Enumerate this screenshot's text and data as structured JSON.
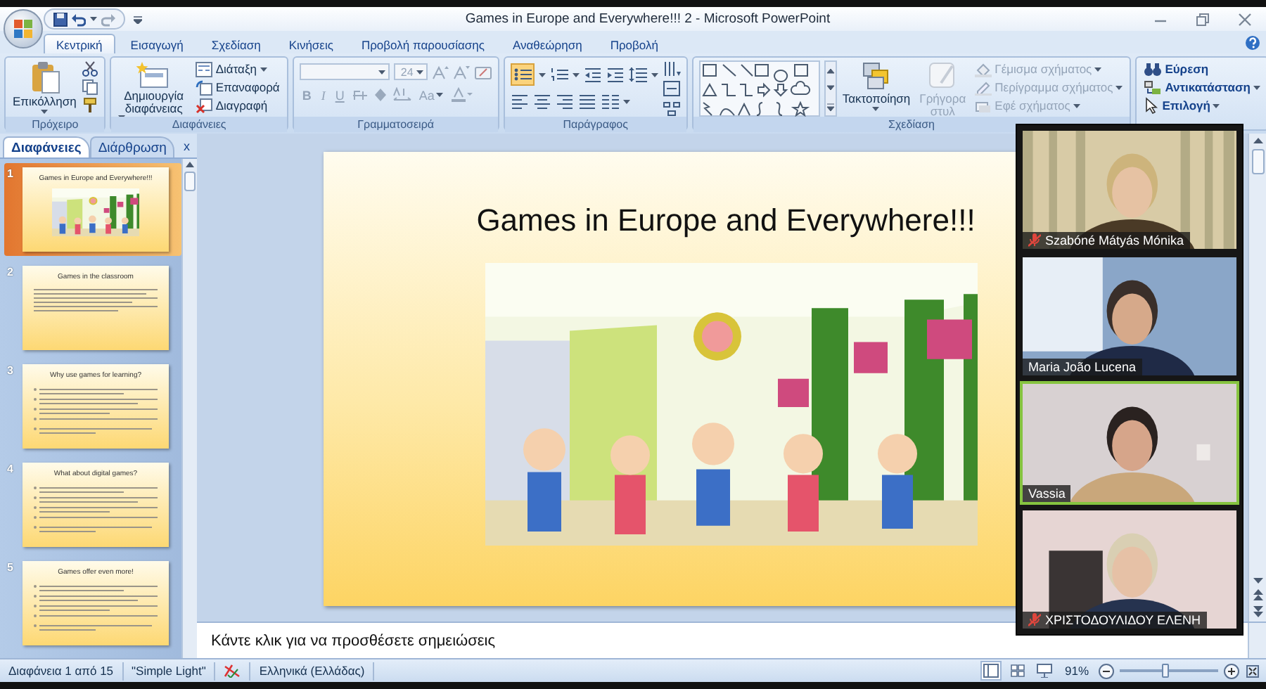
{
  "window": {
    "title": "Games in Europe and Everywhere!!! 2 - Microsoft PowerPoint"
  },
  "ribbon_tabs": [
    {
      "label": "Κεντρική",
      "selected": true
    },
    {
      "label": "Εισαγωγή",
      "selected": false
    },
    {
      "label": "Σχεδίαση",
      "selected": false
    },
    {
      "label": "Κινήσεις",
      "selected": false
    },
    {
      "label": "Προβολή παρουσίασης",
      "selected": false
    },
    {
      "label": "Αναθεώρηση",
      "selected": false
    },
    {
      "label": "Προβολή",
      "selected": false
    }
  ],
  "ribbon_groups": [
    {
      "kind": "clipboard",
      "label": "Πρόχειρο",
      "paste": "Επικόλληση"
    },
    {
      "kind": "slides",
      "label": "Διαφάνειες",
      "new_slide": "Δημιουργία διαφάνειας",
      "commands": [
        {
          "label": "Διάταξη",
          "dropdown": true
        },
        {
          "label": "Επαναφορά",
          "dropdown": false
        },
        {
          "label": "Διαγραφή",
          "dropdown": false
        }
      ]
    },
    {
      "kind": "font",
      "label": "Γραμματοσειρά",
      "font_size": "24",
      "disabled": true,
      "format_buttons": [
        "B",
        "I",
        "U",
        "Aa"
      ]
    },
    {
      "kind": "paragraph",
      "label": "Παράγραφος",
      "bullets_on": true
    },
    {
      "kind": "drawing",
      "label": "Σχεδίαση",
      "arrange": "Τακτοποίηση",
      "quick_styles": "Γρήγορα στυλ",
      "quick_styles_disabled": true,
      "commands": [
        {
          "label": "Γέμισμα σχήματος",
          "disabled": true
        },
        {
          "label": "Περίγραμμα σχήματος",
          "disabled": true
        },
        {
          "label": "Εφέ σχήματος",
          "disabled": true
        }
      ]
    },
    {
      "kind": "editing",
      "commands": [
        {
          "label": "Εύρεση",
          "dropdown": false
        },
        {
          "label": "Αντικατάσταση",
          "dropdown": true
        },
        {
          "label": "Επιλογή",
          "dropdown": true
        }
      ]
    }
  ],
  "slide_panel": {
    "tabs": [
      {
        "label": "Διαφάνειες",
        "selected": true
      },
      {
        "label": "Διάρθρωση",
        "selected": false
      }
    ],
    "close": "x",
    "thumbnails": [
      {
        "number": "1",
        "title": "Games in Europe and Everywhere!!!",
        "kind": "picture",
        "selected": true
      },
      {
        "number": "2",
        "title": "Games in the classroom",
        "kind": "text",
        "selected": false
      },
      {
        "number": "3",
        "title": "Why use games for learning?",
        "kind": "bullets",
        "selected": false
      },
      {
        "number": "4",
        "title": "What about digital games?",
        "kind": "bullets",
        "selected": false
      },
      {
        "number": "5",
        "title": "Games offer even more!",
        "kind": "bullets",
        "selected": false
      }
    ]
  },
  "slide": {
    "title": "Games in Europe and Everywhere!!!"
  },
  "notes": {
    "placeholder": "Κάντε κλικ για να προσθέσετε σημειώσεις"
  },
  "video": {
    "participants": [
      {
        "name": "Szabóné Mátyás Mónika",
        "muted": true,
        "speaking": false
      },
      {
        "name": "Maria João Lucena",
        "muted": false,
        "speaking": false
      },
      {
        "name": "Vassia",
        "muted": false,
        "speaking": true
      },
      {
        "name": "ΧΡΙΣΤΟΔΟΥΛΙΔΟΥ ΕΛΕΝΗ",
        "muted": true,
        "speaking": false
      }
    ]
  },
  "status_bar": {
    "slide_info": "Διαφάνεια 1 από 15",
    "theme": "\"Simple Light\"",
    "language": "Ελληνικά (Ελλάδας)",
    "views": [
      {
        "selected": true
      },
      {
        "selected": false
      },
      {
        "selected": false
      }
    ],
    "zoom": "91%",
    "zoom_slider": {
      "level": 0.45
    }
  }
}
